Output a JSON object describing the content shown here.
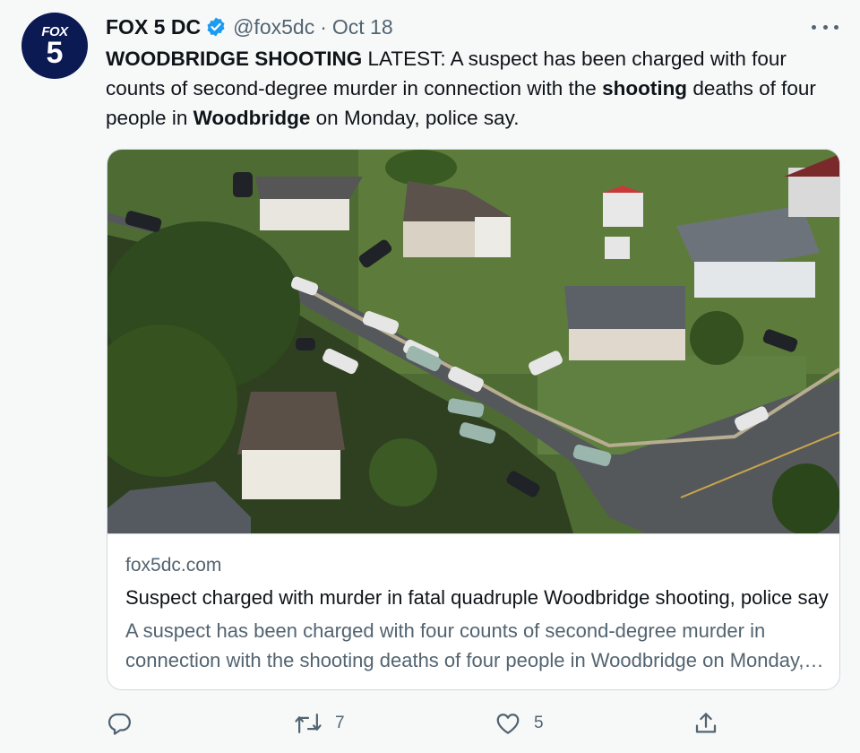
{
  "account": {
    "avatar_text_top": "FOX",
    "avatar_text_bottom": "5",
    "name": "FOX 5 DC",
    "handle": "@fox5dc",
    "separator": "·",
    "date": "Oct 18",
    "verified": true
  },
  "tweet": {
    "segments": [
      {
        "text": "WOODBRIDGE SHOOTING",
        "bold": true
      },
      {
        "text": " LATEST: A suspect has been charged with four counts of second-degree murder in connection with the ",
        "bold": false
      },
      {
        "text": "shooting",
        "bold": true
      },
      {
        "text": " deaths of four people in ",
        "bold": false
      },
      {
        "text": "Woodbridge",
        "bold": true
      },
      {
        "text": " on Monday, police say.",
        "bold": false
      }
    ]
  },
  "card": {
    "image_icon": "aerial-photo-image",
    "domain": "fox5dc.com",
    "title": "Suspect charged with murder in fatal quadruple Woodbridge shooting, police say",
    "description": "A suspect has been charged with four counts of second-degree murder in connection with the shooting deaths of four people in Woodbridge on Monday, police say."
  },
  "actions": {
    "reply_icon": "reply-icon",
    "reply_count": "",
    "retweet_icon": "retweet-icon",
    "retweet_count": "7",
    "like_icon": "heart-icon",
    "like_count": "5",
    "share_icon": "share-icon"
  },
  "colors": {
    "background": "#f7f9f9",
    "text_primary": "#0f1419",
    "text_secondary": "#536471",
    "verified_blue": "#1d9bf0",
    "avatar_navy": "#0c1a54",
    "border": "#cfd9de"
  }
}
